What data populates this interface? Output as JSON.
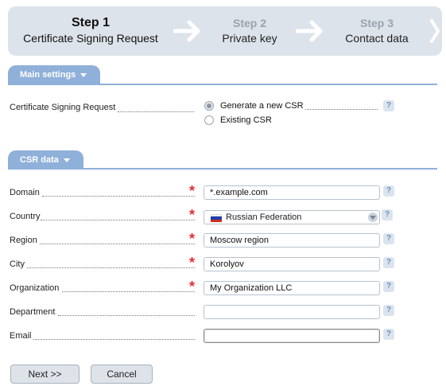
{
  "wizard": {
    "steps": [
      {
        "number": "Step 1",
        "title": "Certificate Signing Request",
        "active": true
      },
      {
        "number": "Step 2",
        "title": "Private key",
        "active": false
      },
      {
        "number": "Step 3",
        "title": "Contact data",
        "active": false
      }
    ]
  },
  "main_settings": {
    "tab_label": "Main settings",
    "csr_label": "Certificate Signing Request",
    "options": [
      {
        "label": "Generate a new CSR",
        "selected": true
      },
      {
        "label": "Existing CSR",
        "selected": false
      }
    ],
    "help": "?"
  },
  "csr_data": {
    "tab_label": "CSR data",
    "fields": {
      "domain": {
        "label": "Domain",
        "value": "*.example.com",
        "required": true
      },
      "country": {
        "label": "Country",
        "value": "Russian Federation",
        "required": true
      },
      "region": {
        "label": "Region",
        "value": "Moscow region",
        "required": true
      },
      "city": {
        "label": "City",
        "value": "Korolyov",
        "required": true
      },
      "organization": {
        "label": "Organization",
        "value": "My Organization LLC",
        "required": true
      },
      "department": {
        "label": "Department",
        "value": "",
        "required": false
      },
      "email": {
        "label": "Email",
        "value": "",
        "required": false
      }
    },
    "required_mark": "*"
  },
  "buttons": {
    "next": "Next >>",
    "cancel": "Cancel"
  },
  "colors": {
    "accent": "#8fb0d9",
    "required": "#e03030",
    "wizard_bg": "#dde3ea"
  }
}
